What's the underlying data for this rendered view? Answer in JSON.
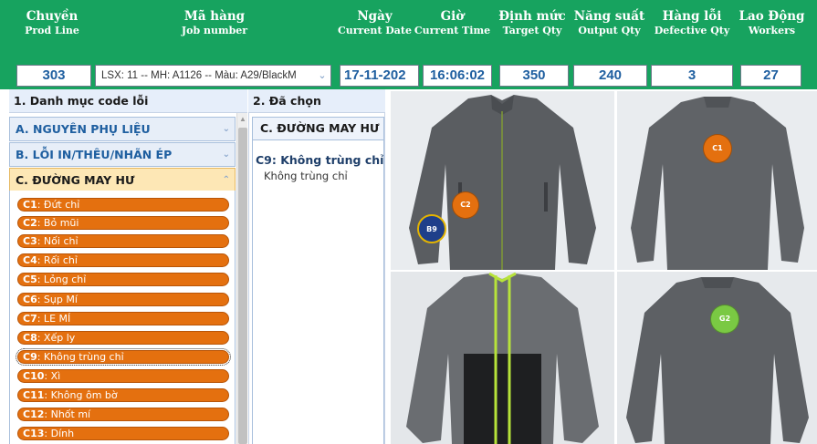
{
  "header": {
    "columns": [
      {
        "vi": "Chuyền",
        "en": "Prod Line"
      },
      {
        "vi": "Mã hàng",
        "en": "Job number"
      },
      {
        "vi": "Ngày",
        "en": "Current Date"
      },
      {
        "vi": "Giờ",
        "en": "Current Time"
      },
      {
        "vi": "Định mức",
        "en": "Target Qty"
      },
      {
        "vi": "Năng suất",
        "en": "Output Qty"
      },
      {
        "vi": "Hàng lỗi",
        "en": "Defective Qty"
      },
      {
        "vi": "Lao Động",
        "en": "Workers"
      }
    ],
    "values": {
      "prod_line": "303",
      "job_number": "LSX: 11 -- MH: A1126 -- Màu: A29/BlackM",
      "date": "17-11-202",
      "time": "16:06:02",
      "target_qty": "350",
      "output_qty": "240",
      "defective_qty": "3",
      "workers": "27"
    },
    "select_arrow": "chevron-down-icon",
    "colors": {
      "band": "#17a35f",
      "value_text": "#1f5fa0"
    }
  },
  "sections": {
    "defect_codes": "1. Danh mục code lỗi",
    "chosen": "2. Đã chọn"
  },
  "categories": [
    {
      "label": "A. NGUYÊN PHỤ LIỆU",
      "state": "collapsed"
    },
    {
      "label": "B. LỖI IN/THÊU/NHÃN ÉP",
      "state": "collapsed"
    },
    {
      "label": "C. ĐƯỜNG MAY HƯ",
      "state": "expanded"
    }
  ],
  "defect_items": [
    {
      "code": "C1",
      "label": ": Đứt chỉ"
    },
    {
      "code": "C2",
      "label": ": Bỏ mũi"
    },
    {
      "code": "C3",
      "label": ": Nối chỉ"
    },
    {
      "code": "C4",
      "label": ": Rối chỉ"
    },
    {
      "code": "C5",
      "label": ": Lỏng chỉ"
    },
    {
      "code": "C6",
      "label": ": Sụp Mí"
    },
    {
      "code": "C7",
      "label": ": LE MÍ"
    },
    {
      "code": "C8",
      "label": ": Xếp ly"
    },
    {
      "code": "C9",
      "label": ": Không trùng chỉ"
    },
    {
      "code": "C10",
      "label": ": Xì"
    },
    {
      "code": "C11",
      "label": ": Không ôm bờ"
    },
    {
      "code": "C12",
      "label": ": Nhốt mí"
    },
    {
      "code": "C13",
      "label": ": Dính"
    }
  ],
  "selected_index": 8,
  "chosen": {
    "category": "C. ĐƯỜNG MAY HƯ",
    "title": "C9: Không trùng chỉ",
    "subtitle": "Không trùng chỉ"
  },
  "photo_badges": [
    {
      "text": "C2",
      "color": "#e4700f"
    },
    {
      "text": "B9",
      "color": "#1f3f8a"
    },
    {
      "text": "C1",
      "color": "#e4700f"
    },
    {
      "text": "G2",
      "color": "#7ac943"
    }
  ],
  "colors": {
    "defect_item": "#e4700f",
    "active_category": "#fde7b5",
    "accent_trim": "#b7e33a"
  }
}
